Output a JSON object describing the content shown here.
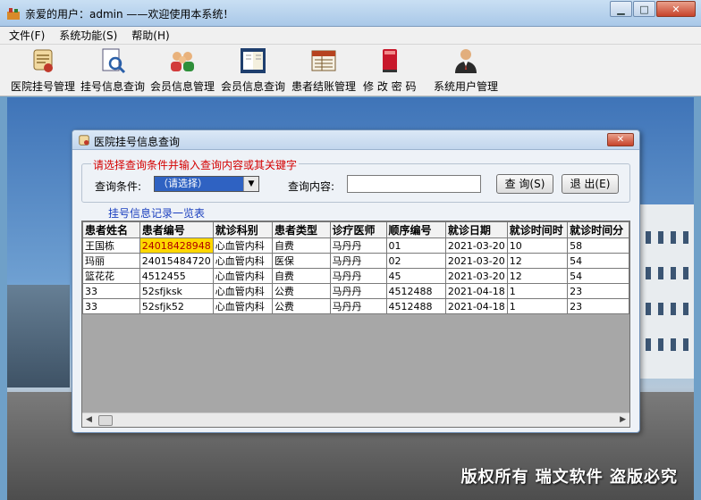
{
  "window": {
    "title": "亲爱的用户：admin ——欢迎使用本系统！"
  },
  "menu": [
    "文件(F)",
    "系统功能(S)",
    "帮助(H)"
  ],
  "toolbar": [
    {
      "label": "医院挂号管理",
      "icon": "scroll-icon"
    },
    {
      "label": "挂号信息查询",
      "icon": "magnifier-document-icon"
    },
    {
      "label": "会员信息管理",
      "icon": "users-icon"
    },
    {
      "label": "会员信息查询",
      "icon": "book-icon"
    },
    {
      "label": "患者结账管理",
      "icon": "ledger-icon"
    },
    {
      "label": "修  改  密  码",
      "icon": "red-book-icon"
    },
    {
      "label": "系统用户管理",
      "icon": "user-icon"
    }
  ],
  "dialog": {
    "title": "医院挂号信息查询",
    "criteria_legend": "请选择查询条件并输入查询内容或其关键字",
    "condition_label": "查询条件:",
    "condition_value": "（请选择）",
    "content_label": "查询内容:",
    "content_value": "",
    "query_button": "查 询(S)",
    "exit_button": "退 出(E)",
    "list_legend": "挂号信息记录一览表",
    "columns": [
      "患者姓名",
      "患者编号",
      "就诊科别",
      "患者类型",
      "诊疗医师",
      "顺序编号",
      "就诊日期",
      "就诊时间时",
      "就诊时间分"
    ],
    "rows": [
      [
        "王国栋",
        "24018428948",
        "心血管内科",
        "自费",
        "马丹丹",
        "01",
        "2021-03-20",
        "10",
        "58"
      ],
      [
        "玛丽",
        "24015484720",
        "心血管内科",
        "医保",
        "马丹丹",
        "02",
        "2021-03-20",
        "12",
        "54"
      ],
      [
        "篮花花",
        "4512455",
        "心血管内科",
        "自费",
        "马丹丹",
        "45",
        "2021-03-20",
        "12",
        "54"
      ],
      [
        "33",
        "52sfjksk",
        "心血管内科",
        "公费",
        "马丹丹",
        "4512488",
        "2021-04-18",
        "1",
        "23"
      ],
      [
        "33",
        "52sfjk52",
        "心血管内科",
        "公费",
        "马丹丹",
        "4512488",
        "2021-04-18",
        "1",
        "23"
      ]
    ]
  },
  "footer": {
    "copyright": "版权所有  瑞文软件  盗版必究"
  }
}
